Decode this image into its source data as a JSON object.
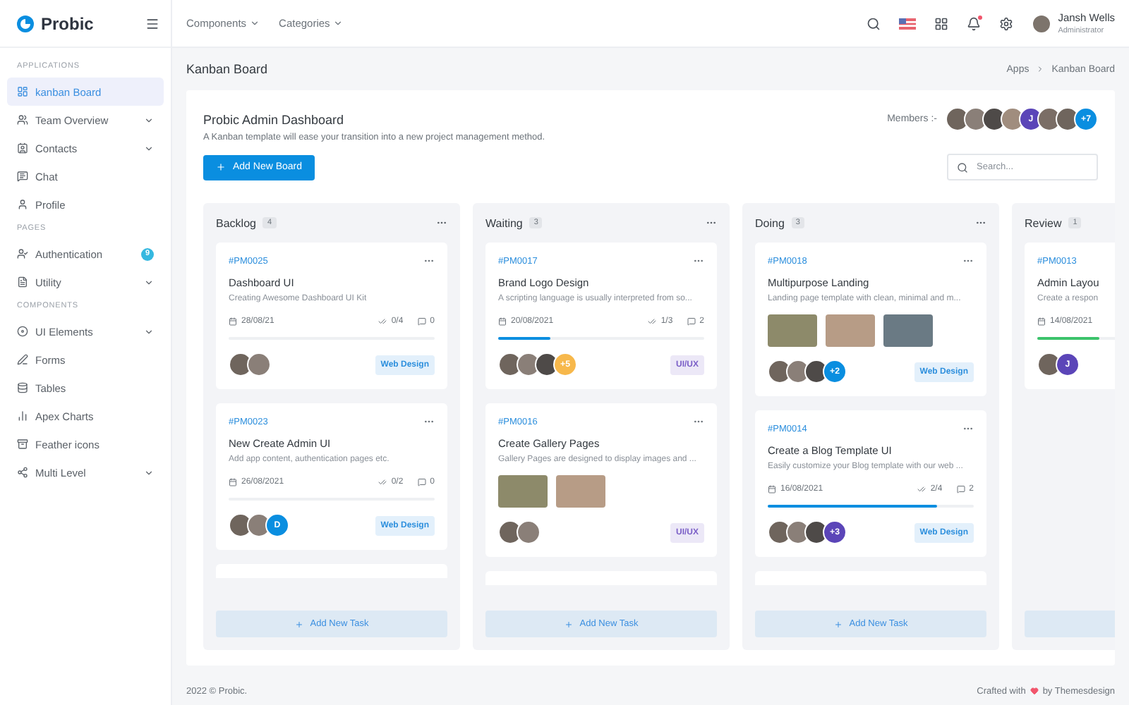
{
  "brand": {
    "name": "Probic"
  },
  "topnav": [
    {
      "label": "Components"
    },
    {
      "label": "Categories"
    }
  ],
  "notifications": {
    "unread": true
  },
  "user": {
    "name": "Jansh Wells",
    "role": "Administrator"
  },
  "sidebar": [
    {
      "heading": "APPLICATIONS",
      "items": [
        {
          "label": "kanban Board",
          "selected": true,
          "expandable": false
        },
        {
          "label": "Team Overview",
          "selected": false,
          "expandable": true
        },
        {
          "label": "Contacts",
          "selected": false,
          "expandable": true
        },
        {
          "label": "Chat",
          "selected": false,
          "expandable": false
        },
        {
          "label": "Profile",
          "selected": false,
          "expandable": false
        }
      ]
    },
    {
      "heading": "PAGES",
      "items": [
        {
          "label": "Authentication",
          "selected": false,
          "expandable": false,
          "badge": "9"
        },
        {
          "label": "Utility",
          "selected": false,
          "expandable": true
        }
      ]
    },
    {
      "heading": "COMPONENTS",
      "items": [
        {
          "label": "UI Elements",
          "selected": false,
          "expandable": true
        },
        {
          "label": "Forms",
          "selected": false,
          "expandable": false
        },
        {
          "label": "Tables",
          "selected": false,
          "expandable": false
        },
        {
          "label": "Apex Charts",
          "selected": false,
          "expandable": false
        },
        {
          "label": "Feather icons",
          "selected": false,
          "expandable": false
        },
        {
          "label": "Multi Level",
          "selected": false,
          "expandable": true
        }
      ]
    }
  ],
  "page": {
    "title": "Kanban Board",
    "breadcrumb": [
      "Apps",
      "Kanban Board"
    ]
  },
  "board": {
    "title": "Probic Admin Dashboard",
    "subtitle": "A Kanban template will ease your transition into a new project management method.",
    "add_button": "Add New Board",
    "members_label": "Members :-",
    "members": [
      {
        "kind": "photo"
      },
      {
        "kind": "photo"
      },
      {
        "kind": "photo"
      },
      {
        "kind": "photo"
      },
      {
        "kind": "initial",
        "text": "J",
        "color": "#5b45b8"
      },
      {
        "kind": "photo"
      },
      {
        "kind": "photo"
      },
      {
        "kind": "more",
        "text": "+7",
        "color": "#0a8ee0"
      }
    ],
    "search": {
      "placeholder": "Search..."
    },
    "columns": [
      {
        "title": "Backlog",
        "count": "4",
        "more_below": true,
        "add_button": "Add New Task",
        "cards": [
          {
            "kind": "progress",
            "id": "#PM0025",
            "title": "Dashboard UI",
            "description": "Creating Awesome Dashboard UI Kit",
            "date": "28/08/21",
            "checklist": "0/4",
            "comments": "0",
            "avatars": [
              {
                "kind": "photo"
              },
              {
                "kind": "photo"
              }
            ],
            "tag": {
              "text": "Web Design",
              "color": "#2d8fdd"
            }
          },
          {
            "kind": "progress",
            "id": "#PM0023",
            "title": "New Create Admin UI",
            "description": "Add app content, authentication pages etc.",
            "date": "26/08/2021",
            "checklist": "0/2",
            "comments": "0",
            "avatars": [
              {
                "kind": "photo"
              },
              {
                "kind": "photo"
              },
              {
                "kind": "initial",
                "text": "D",
                "color": "#0a8ee0"
              }
            ],
            "tag": {
              "text": "Web Design",
              "color": "#2d8fdd"
            }
          }
        ]
      },
      {
        "title": "Waiting",
        "count": "3",
        "more_below": true,
        "add_button": "Add New Task",
        "cards": [
          {
            "kind": "progress",
            "id": "#PM0017",
            "title": "Brand Logo Design",
            "description": "A scripting language is usually interpreted from so...",
            "date": "20/08/2021",
            "checklist": "1/3",
            "comments": "2",
            "progress": {
              "level": 0.25,
              "color": "#0a8ee0"
            },
            "avatars": [
              {
                "kind": "photo"
              },
              {
                "kind": "photo"
              },
              {
                "kind": "photo"
              },
              {
                "kind": "more",
                "text": "+5",
                "color": "#f7b84b"
              }
            ],
            "tag": {
              "text": "UI/UX",
              "color": "#7a5ec7"
            }
          },
          {
            "kind": "gallery",
            "id": "#PM0016",
            "title": "Create Gallery Pages",
            "description": "Gallery Pages are designed to display images and ...",
            "photos": [
              {
                "kind": "photo"
              },
              {
                "kind": "photo"
              }
            ],
            "avatars": [
              {
                "kind": "photo"
              },
              {
                "kind": "photo"
              }
            ],
            "tag": {
              "text": "UI/UX",
              "color": "#7a5ec7"
            }
          }
        ]
      },
      {
        "title": "Doing",
        "count": "3",
        "more_below": true,
        "add_button": "Add New Task",
        "cards": [
          {
            "kind": "gallery",
            "id": "#PM0018",
            "title": "Multipurpose Landing",
            "description": "Landing page template with clean, minimal and m...",
            "photos": [
              {
                "kind": "photo"
              },
              {
                "kind": "photo"
              },
              {
                "kind": "photo"
              }
            ],
            "avatars": [
              {
                "kind": "photo"
              },
              {
                "kind": "photo"
              },
              {
                "kind": "photo"
              },
              {
                "kind": "more",
                "text": "+2",
                "color": "#0a8ee0"
              }
            ],
            "tag": {
              "text": "Web Design",
              "color": "#2d8fdd"
            }
          },
          {
            "kind": "progress",
            "id": "#PM0014",
            "title": "Create a Blog Template UI",
            "description": "Easily customize your Blog template with our web ...",
            "date": "16/08/2021",
            "checklist": "2/4",
            "comments": "2",
            "progress": {
              "level": 0.82,
              "color": "#0a8ee0"
            },
            "avatars": [
              {
                "kind": "photo"
              },
              {
                "kind": "photo"
              },
              {
                "kind": "photo"
              },
              {
                "kind": "more",
                "text": "+3",
                "color": "#5b45b8"
              }
            ],
            "tag": {
              "text": "Web Design",
              "color": "#2d8fdd"
            }
          }
        ]
      },
      {
        "title": "Review",
        "count": "1",
        "more_below": false,
        "cards": [
          {
            "kind": "progress",
            "id": "#PM0013",
            "title": "Admin Layou",
            "description": "Create a respon",
            "date": "14/08/2021",
            "progress": {
              "level": 0.3,
              "color": "#3cc36b"
            },
            "avatars": [
              {
                "kind": "photo"
              },
              {
                "kind": "initial",
                "text": "J",
                "color": "#5b45b8"
              }
            ]
          }
        ]
      }
    ]
  },
  "footer": {
    "copyright": "2022 © Probic.",
    "credit_before": "Crafted with",
    "credit_after": "by Themesdesign"
  }
}
